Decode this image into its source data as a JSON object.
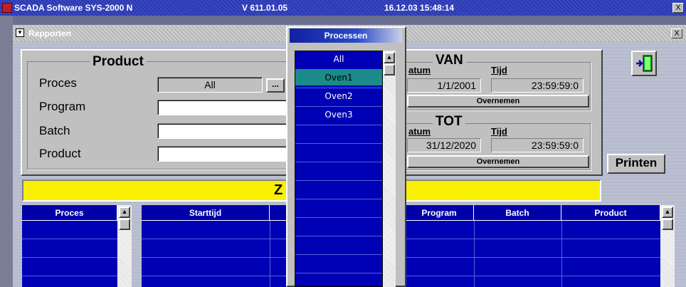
{
  "titlebar": {
    "app_name": "SCADA Software  SYS-2000 N",
    "version": "V 611.01.05",
    "datetime": "16.12.03  15:48:14",
    "close": "X"
  },
  "rapporten": {
    "title": "Rapporten",
    "close": "X"
  },
  "product_group": {
    "title": "Product",
    "proces_label": "Proces",
    "proces_value": "All",
    "browse_button": "...",
    "program_label": "Program",
    "program_value": "",
    "batch_label": "Batch",
    "batch_value": "",
    "product_label": "Product",
    "product_value": ""
  },
  "van": {
    "title": "VAN",
    "datum_label": "atum",
    "tijd_label": "Tijd",
    "datum_value": "1/1/2001",
    "tijd_value": "23:59:59:0",
    "button": "Overnemen"
  },
  "tot": {
    "title": "TOT",
    "datum_label": "atum",
    "tijd_label": "Tijd",
    "datum_value": "31/12/2020",
    "tijd_value": "23:59:59:0",
    "button": "Overnemen"
  },
  "printen_button": "Printen",
  "yellow_bar_text": "Z",
  "left_table": {
    "header": "Proces"
  },
  "main_table": {
    "headers": [
      "Starttijd",
      "",
      "Program",
      "Batch",
      "Product"
    ]
  },
  "processen": {
    "title": "Processen",
    "items": [
      "All",
      "Oven1",
      "Oven2",
      "Oven3"
    ],
    "selected": "Oven1"
  },
  "colors": {
    "table_blue": "#0000b4",
    "selected_teal": "#1a8a8a",
    "yellow": "#f8f000"
  }
}
